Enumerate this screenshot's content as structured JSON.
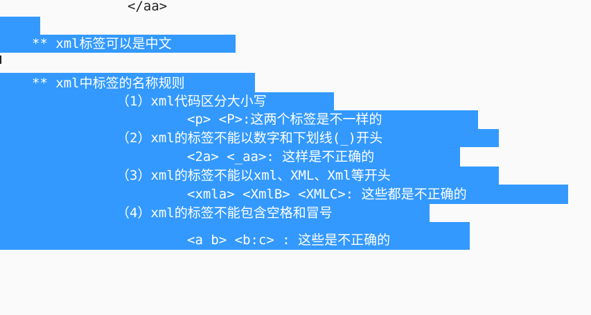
{
  "editor": {
    "selection_color": "#3399ff",
    "lines": [
      {
        "text": "</aa>",
        "selected": false
      },
      {
        "text": "",
        "selected": true
      },
      {
        "text": "** xml标签可以是中文",
        "selected": true
      },
      {
        "text": "",
        "selected": true
      },
      {
        "text": "** xml中标签的名称规则",
        "selected": true
      },
      {
        "text": "（1）xml代码区分大小写",
        "selected": true
      },
      {
        "text": "<p> <P>:这两个标签是不一样的",
        "selected": true
      },
      {
        "text": "（2）xml的标签不能以数字和下划线(_)开头",
        "selected": true
      },
      {
        "text": "<2a> <_aa>: 这样是不正确的",
        "selected": true
      },
      {
        "text": "（3）xml的标签不能以xml、XML、Xml等开头",
        "selected": true
      },
      {
        "text": "<xmla> <XmlB> <XMLC>: 这些都是不正确的",
        "selected": true
      },
      {
        "text": "（4）xml的标签不能包含空格和冒号",
        "selected": true
      },
      {
        "text": "<a b> <b:c> : 这些是不正确的",
        "selected": true
      }
    ]
  }
}
